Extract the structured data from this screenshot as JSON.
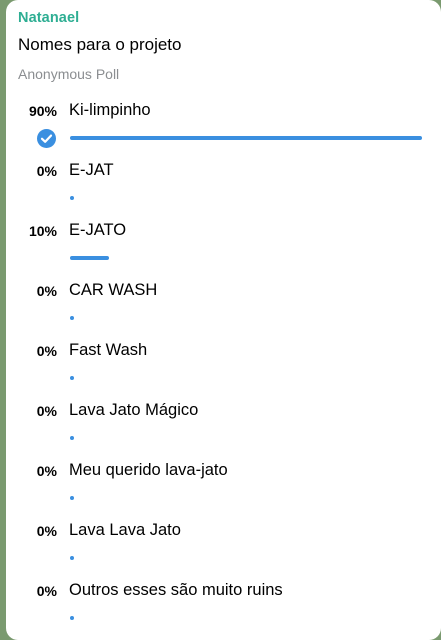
{
  "message": {
    "sender": "Natanael",
    "question": "Nomes para o projeto",
    "poll_type": "Anonymous Poll"
  },
  "poll": {
    "accent_color": "#3a8fe0",
    "options": [
      {
        "percent_label": "90%",
        "label": "Ki-limpinho",
        "share": 0.9,
        "chosen": true
      },
      {
        "percent_label": "0%",
        "label": "E-JAT",
        "share": 0.0,
        "chosen": false
      },
      {
        "percent_label": "10%",
        "label": "E-JATO",
        "share": 0.1,
        "chosen": false
      },
      {
        "percent_label": "0%",
        "label": "CAR WASH",
        "share": 0.0,
        "chosen": false
      },
      {
        "percent_label": "0%",
        "label": "Fast Wash",
        "share": 0.0,
        "chosen": false
      },
      {
        "percent_label": "0%",
        "label": "Lava Jato Mágico",
        "share": 0.0,
        "chosen": false
      },
      {
        "percent_label": "0%",
        "label": "Meu querido lava-jato",
        "share": 0.0,
        "chosen": false
      },
      {
        "percent_label": "0%",
        "label": "Lava Lava Jato",
        "share": 0.0,
        "chosen": false
      },
      {
        "percent_label": "0%",
        "label": "Outros esses são muito ruins",
        "share": 0.0,
        "chosen": false
      }
    ]
  }
}
